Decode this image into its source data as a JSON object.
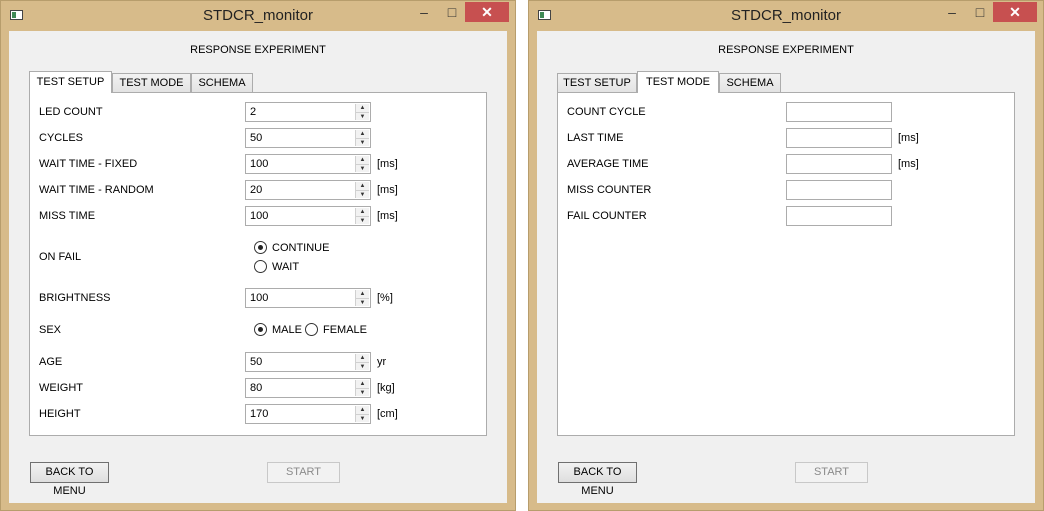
{
  "windows": [
    {
      "title": "STDCR_monitor",
      "heading": "RESPONSE EXPERIMENT",
      "tabs": [
        "TEST SETUP",
        "TEST MODE",
        "SCHEMA"
      ],
      "active_tab": "TEST SETUP",
      "buttons": {
        "back": "BACK TO MENU",
        "start": "START"
      }
    },
    {
      "title": "STDCR_monitor",
      "heading": "RESPONSE EXPERIMENT",
      "tabs": [
        "TEST SETUP",
        "TEST MODE",
        "SCHEMA"
      ],
      "active_tab": "TEST MODE",
      "buttons": {
        "back": "BACK TO MENU",
        "start": "START"
      }
    }
  ],
  "titlebar_buttons": {
    "minimize": "–",
    "maximize": "□",
    "close": "✕"
  },
  "test_setup": {
    "led_count": {
      "label": "LED COUNT",
      "value": "2"
    },
    "cycles": {
      "label": "CYCLES",
      "value": "50"
    },
    "wait_fixed": {
      "label": "WAIT TIME - FIXED",
      "value": "100",
      "unit": "[ms]"
    },
    "wait_random": {
      "label": "WAIT TIME - RANDOM",
      "value": "20",
      "unit": "[ms]"
    },
    "miss_time": {
      "label": "MISS TIME",
      "value": "100",
      "unit": "[ms]"
    },
    "on_fail": {
      "label": "ON FAIL",
      "options": [
        "CONTINUE",
        "WAIT"
      ],
      "selected": "CONTINUE"
    },
    "brightness": {
      "label": "BRIGHTNESS",
      "value": "100",
      "unit": "[%]"
    },
    "sex": {
      "label": "SEX",
      "options": [
        "MALE",
        "FEMALE"
      ],
      "selected": "MALE"
    },
    "age": {
      "label": "AGE",
      "value": "50",
      "unit": "yr"
    },
    "weight": {
      "label": "WEIGHT",
      "value": "80",
      "unit": "[kg]"
    },
    "height": {
      "label": "HEIGHT",
      "value": "170",
      "unit": "[cm]"
    }
  },
  "test_mode": {
    "count_cycle": {
      "label": "COUNT CYCLE",
      "value": ""
    },
    "last_time": {
      "label": "LAST TIME",
      "value": "",
      "unit": "[ms]"
    },
    "average_time": {
      "label": "AVERAGE TIME",
      "value": "",
      "unit": "[ms]"
    },
    "miss_counter": {
      "label": "MISS COUNTER",
      "value": ""
    },
    "fail_counter": {
      "label": "FAIL COUNTER",
      "value": ""
    }
  },
  "icons": {
    "spin_up": "▲",
    "spin_down": "▼"
  },
  "colors": {
    "window_frame": "#d7bb8a",
    "close_button": "#c75050",
    "client_bg": "#f0f0f0"
  }
}
